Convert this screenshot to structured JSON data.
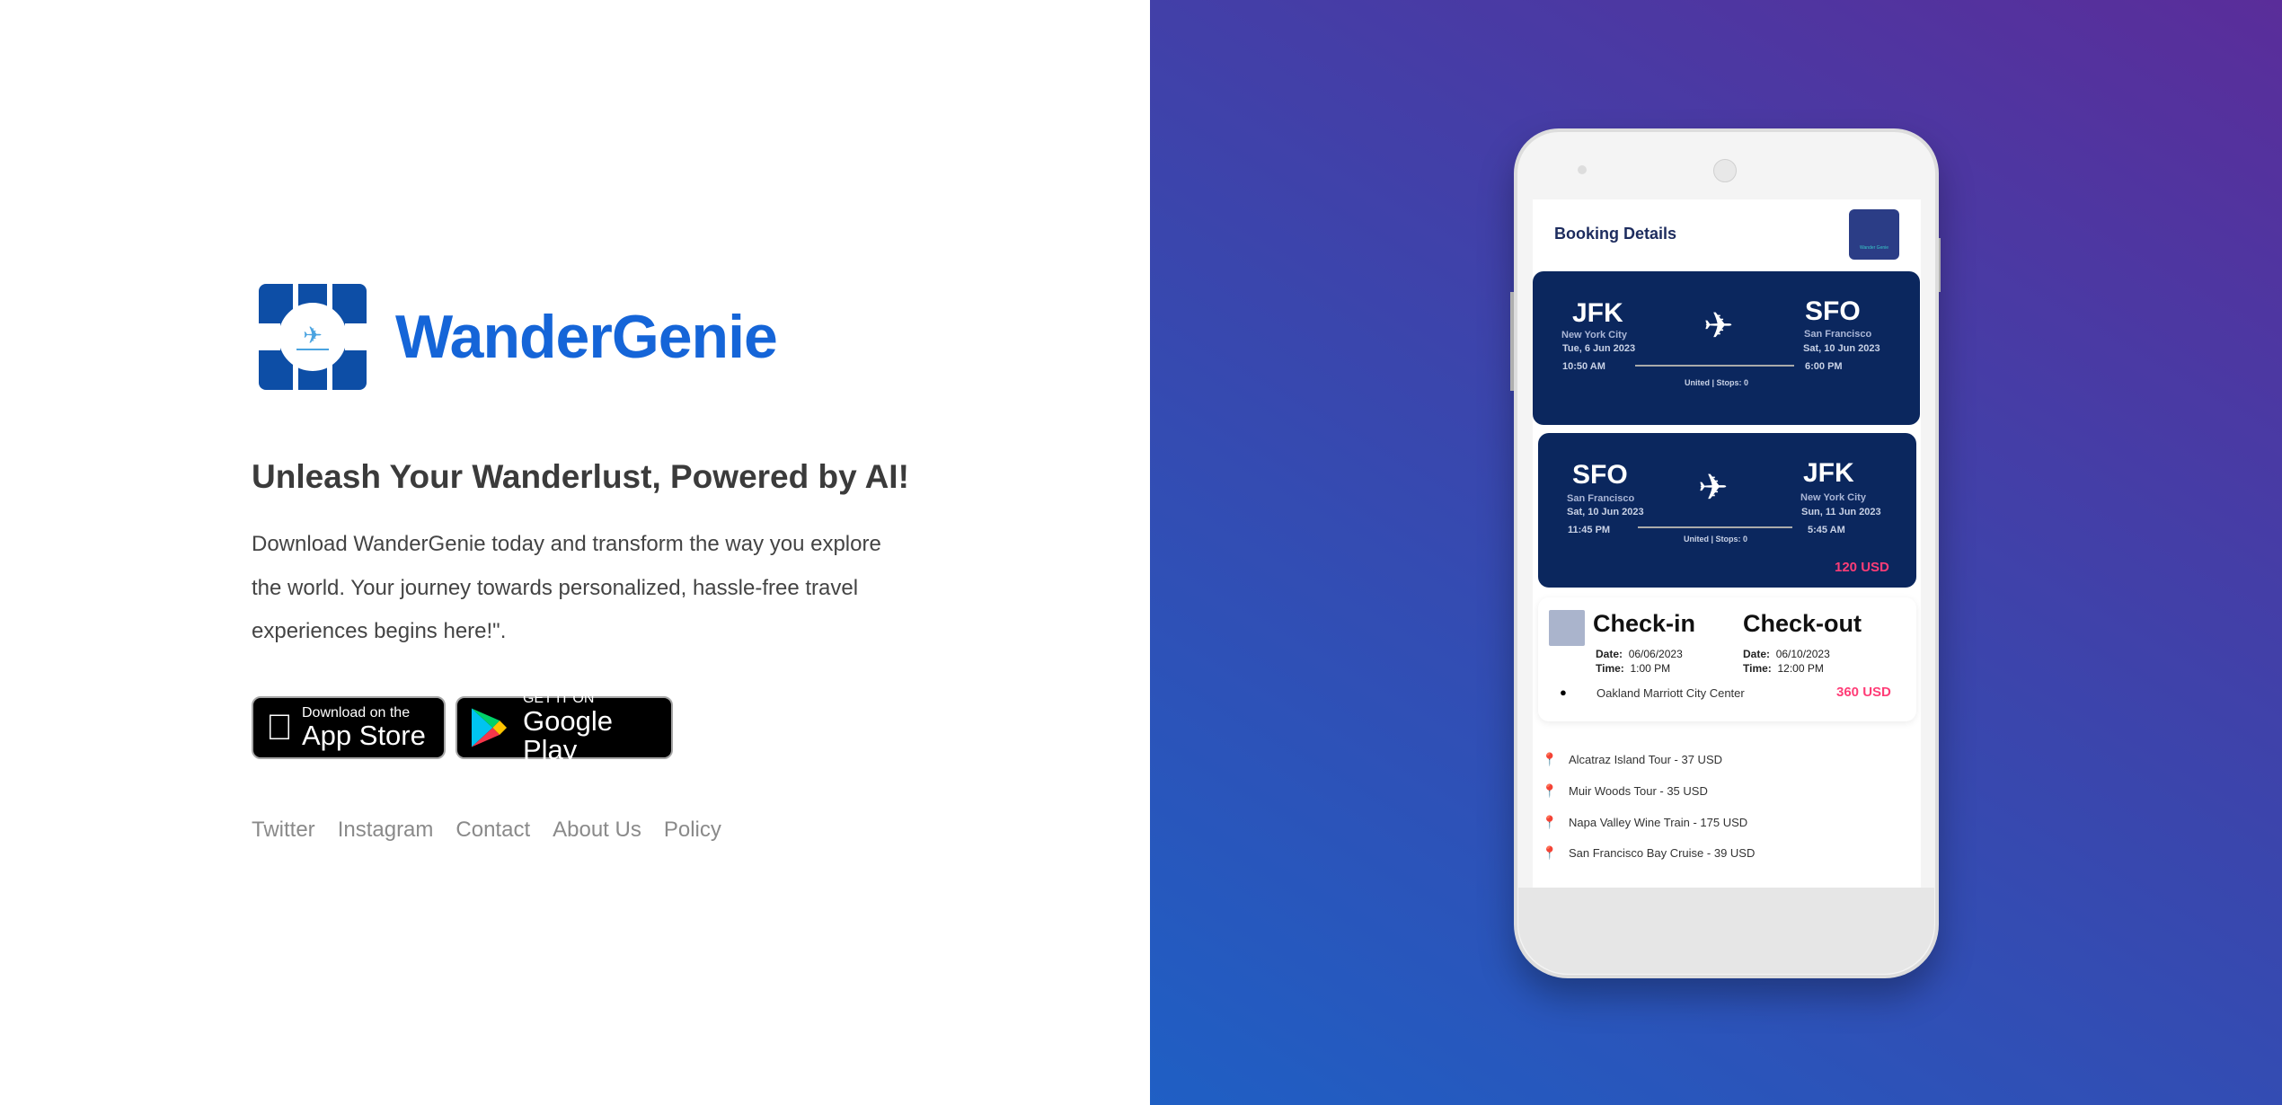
{
  "brand": {
    "name": "WanderGenie",
    "primary_color": "#1565d8",
    "logo_color": "#0d4ea6"
  },
  "hero": {
    "headline": "Unleash Your Wanderlust, Powered by AI!",
    "paragraph": "Download WanderGenie today and transform the way you explore the world. Your journey towards personalized, hassle-free travel experiences begins here!\"."
  },
  "stores": {
    "app_store": {
      "small": "Download on the",
      "big": "App Store",
      "icon": "apple-icon"
    },
    "google_play": {
      "small": "GET IT ON",
      "big": "Google Play",
      "icon": "google-play-icon"
    }
  },
  "footer_links": [
    "Twitter",
    "Instagram",
    "Contact",
    "About Us",
    "Policy"
  ],
  "phone": {
    "title": "Booking Details",
    "badge_text": "Wander Genie",
    "flights": [
      {
        "from": "JFK",
        "from_city": "New York City",
        "from_date": "Tue, 6 Jun 2023",
        "from_time": "10:50 AM",
        "to": "SFO",
        "to_city": "San Francisco",
        "to_date": "Sat, 10 Jun 2023",
        "to_time": "6:00 PM",
        "airline": "United | Stops: 0"
      },
      {
        "from": "SFO",
        "from_city": "San Francisco",
        "from_date": "Sat, 10 Jun 2023",
        "from_time": "11:45 PM",
        "to": "JFK",
        "to_city": "New York City",
        "to_date": "Sun, 11 Jun 2023",
        "to_time": "5:45 AM",
        "airline": "United | Stops: 0",
        "price": "120 USD"
      }
    ],
    "hotel": {
      "checkin_label": "Check-in",
      "checkout_label": "Check-out",
      "date_label": "Date:",
      "time_label": "Time:",
      "checkin_date": "06/06/2023",
      "checkin_time": "1:00 PM",
      "checkout_date": "06/10/2023",
      "checkout_time": "12:00 PM",
      "name": "Oakland Marriott City Center",
      "price": "360 USD"
    },
    "activities": [
      "Alcatraz Island Tour - 37 USD",
      "Muir Woods Tour - 35 USD",
      "Napa Valley Wine Train - 175 USD",
      "San Francisco Bay Cruise - 39 USD"
    ],
    "accent_price_color": "#ff3d77",
    "card_color": "#0b275e"
  }
}
